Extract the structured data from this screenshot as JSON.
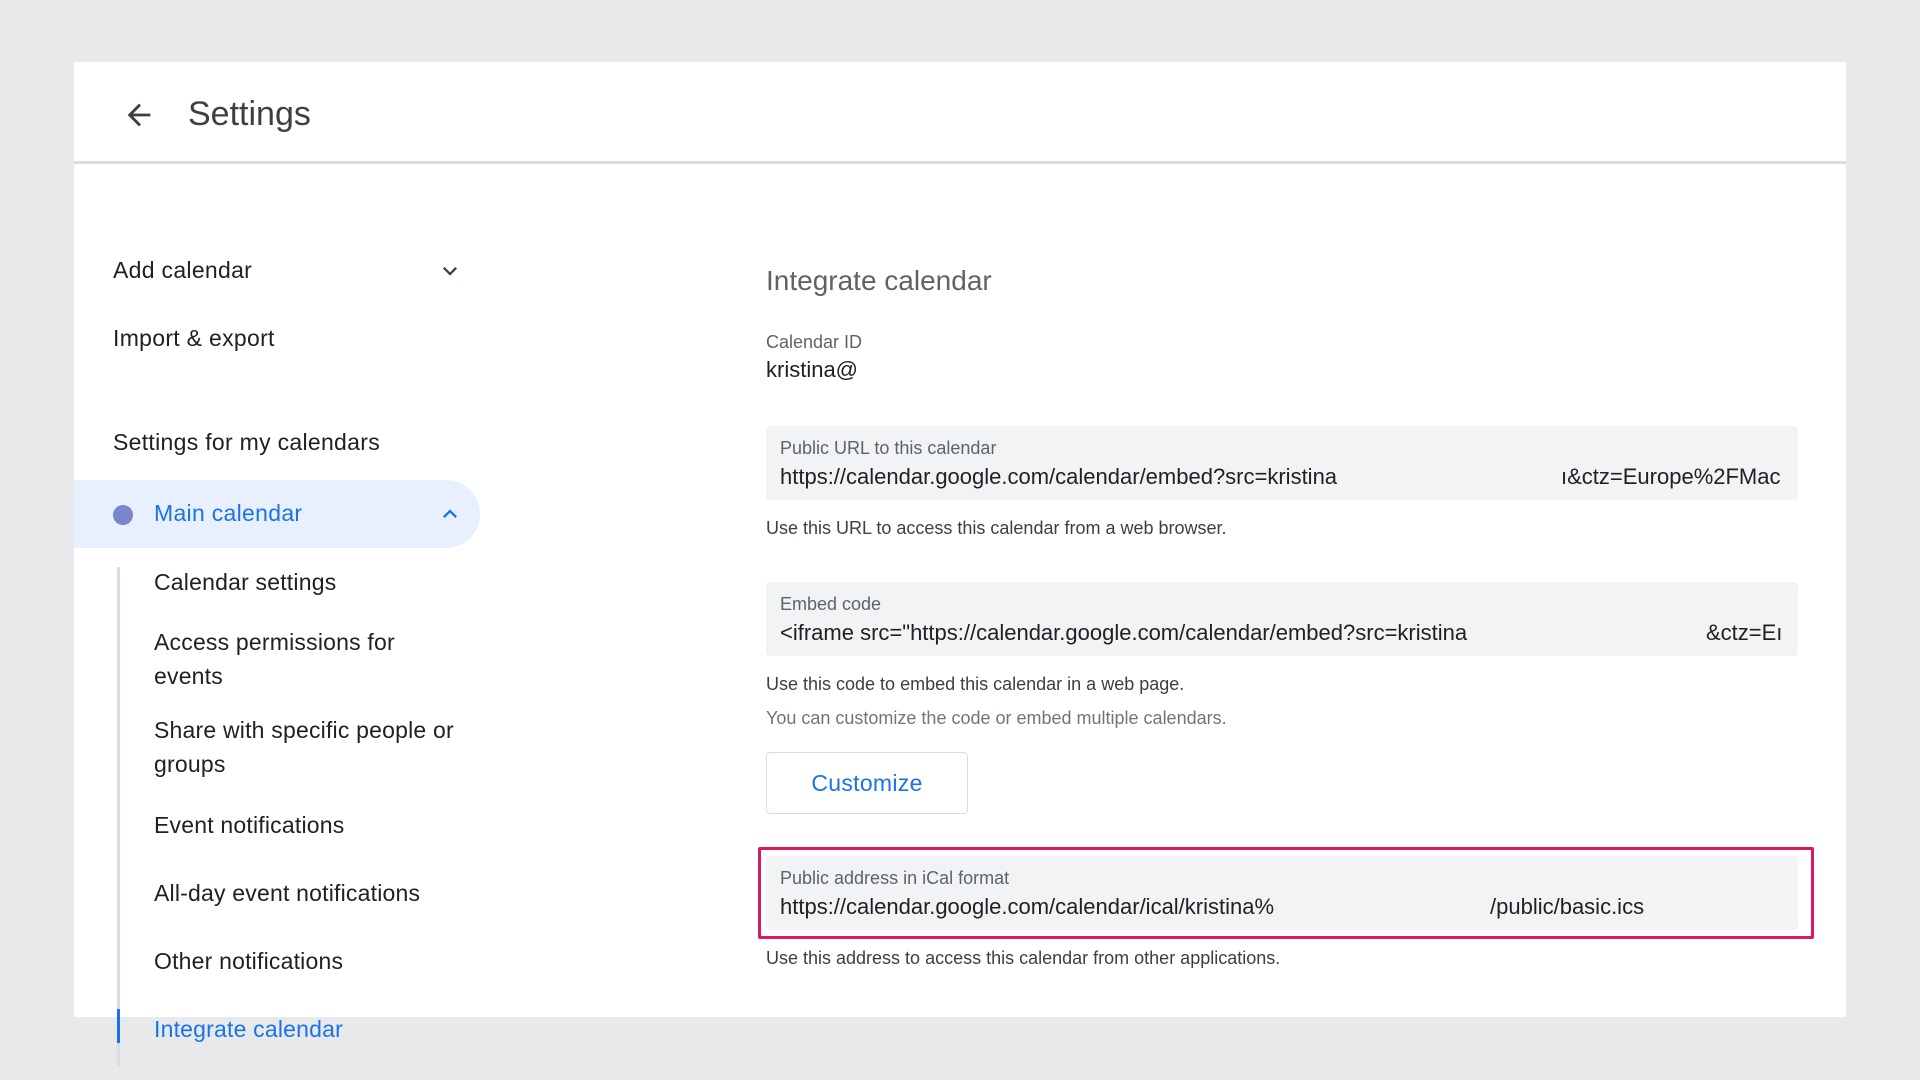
{
  "header": {
    "title": "Settings"
  },
  "sidebar": {
    "add_calendar": "Add calendar",
    "import_export": "Import & export",
    "section_heading": "Settings for my calendars",
    "main_calendar": "Main calendar",
    "main_calendar_color": "#7986cb",
    "subitems": [
      "Calendar settings",
      "Access permissions for events",
      "Share with specific people or groups",
      "Event notifications",
      "All-day event notifications",
      "Other notifications",
      "Integrate calendar"
    ],
    "active_subitem": "Integrate calendar"
  },
  "main": {
    "section_title": "Integrate calendar",
    "calendar_id_label": "Calendar ID",
    "calendar_id_value": "kristina@",
    "public_url": {
      "label": "Public URL to this calendar",
      "value_left": "https://calendar.google.com/calendar/embed?src=kristina",
      "value_right": "ı&ctz=Europe%2FMac",
      "helper": "Use this URL to access this calendar from a web browser."
    },
    "embed_code": {
      "label": "Embed code",
      "value_left": "<iframe src=\"https://calendar.google.com/calendar/embed?src=kristina",
      "value_right": "&ctz=Eı",
      "helper": "Use this code to embed this calendar in a web page.",
      "helper2": "You can customize the code or embed multiple calendars."
    },
    "customize_label": "Customize",
    "ical": {
      "label": "Public address in iCal format",
      "value_left": "https://calendar.google.com/calendar/ical/kristina%",
      "value_right": "/public/basic.ics",
      "helper": "Use this address to access this calendar from other applications."
    }
  },
  "colors": {
    "accent": "#1a73e8",
    "highlight": "#d81b60",
    "field_bg": "#f1f3f4"
  }
}
